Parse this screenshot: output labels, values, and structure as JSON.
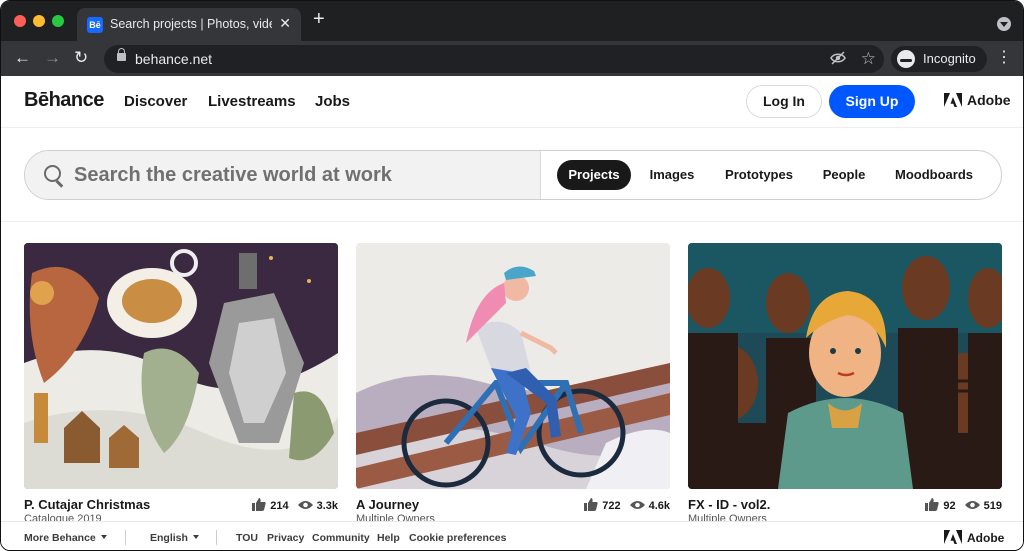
{
  "browser": {
    "tab_title": "Search projects | Photos, videos",
    "tab_favicon": "Bē",
    "url": "behance.net",
    "incognito_label": "Incognito"
  },
  "header": {
    "logo": "Bēhance",
    "nav": [
      "Discover",
      "Livestreams",
      "Jobs"
    ],
    "login": "Log In",
    "signup": "Sign Up",
    "adobe": "Adobe"
  },
  "search": {
    "placeholder": "Search the creative world at work",
    "filters": [
      "Projects",
      "Images",
      "Prototypes",
      "People",
      "Moodboards"
    ],
    "active_filter": "Projects"
  },
  "cards": [
    {
      "title": "P. Cutajar Christmas",
      "subtitle": "Catalogue 2019",
      "likes": "214",
      "views": "3.3k"
    },
    {
      "title": "A Journey",
      "subtitle": "Multiple Owners",
      "likes": "722",
      "views": "4.6k"
    },
    {
      "title": "FX - ID - vol2.",
      "subtitle": "Multiple Owners",
      "likes": "92",
      "views": "519"
    }
  ],
  "footer": {
    "more": "More Behance",
    "language": "English",
    "links": [
      "TOU",
      "Privacy",
      "Community",
      "Help",
      "Cookie preferences"
    ],
    "adobe": "Adobe"
  },
  "colors": {
    "accent_blue": "#0057ff",
    "chrome_dark": "#1f2022",
    "active_filter_bg": "#191919"
  }
}
